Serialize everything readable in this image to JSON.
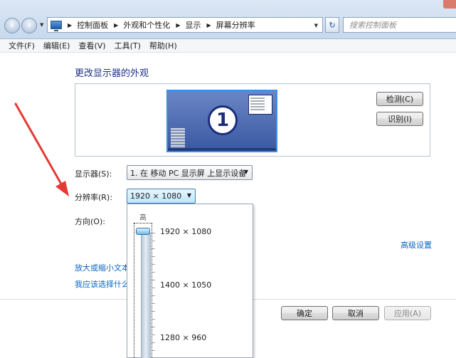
{
  "address_bar": {
    "breadcrumbs": [
      "控制面板",
      "外观和个性化",
      "显示",
      "屏幕分辨率"
    ],
    "search_placeholder": "搜索控制面板"
  },
  "menu": [
    "文件(F)",
    "编辑(E)",
    "查看(V)",
    "工具(T)",
    "帮助(H)"
  ],
  "page": {
    "title": "更改显示器的外观",
    "monitor_number": "1",
    "detect_button": "检测(C)",
    "identify_button": "识别(I)",
    "display_label": "显示器(S):",
    "display_value": "1. 在 移动 PC 显示屏 上显示设备",
    "resolution_label": "分辨率(R):",
    "resolution_value": "1920 × 1080",
    "orientation_label": "方向(O):",
    "advanced_link": "高级设置",
    "link_enlarge": "放大或缩小文本",
    "link_choose": "我应该选择什么"
  },
  "resolution_dropdown": {
    "top_label": "高",
    "options": [
      "1920 × 1080",
      "1400 × 1050",
      "1280 × 960"
    ],
    "selected_fraction": 0
  },
  "footer": {
    "ok": "确定",
    "cancel": "取消",
    "apply": "应用(A)"
  },
  "colors": {
    "title": "#1e3287",
    "link": "#0b66c2",
    "annotation": "#e53935"
  }
}
